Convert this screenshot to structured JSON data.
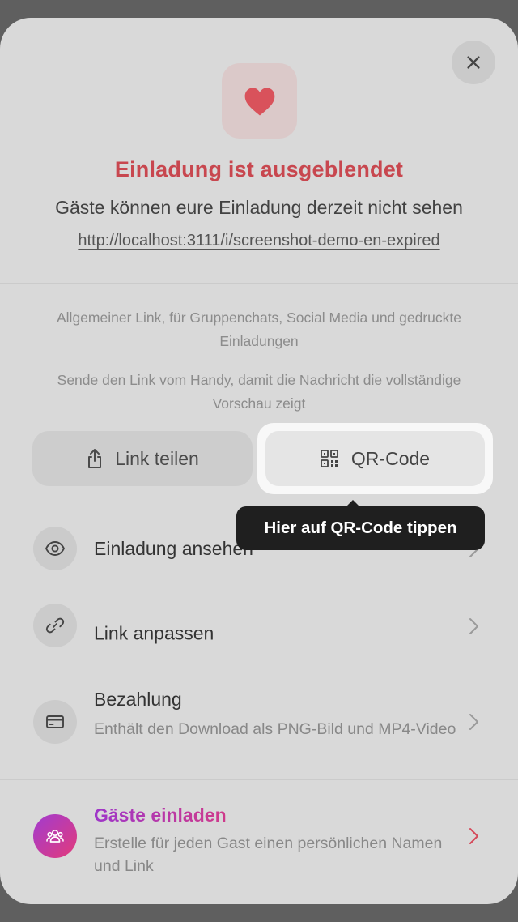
{
  "header": {
    "title": "Einladung ist ausgeblendet",
    "subtitle": "Gäste können eure Einladung derzeit nicht sehen",
    "url": "http://localhost:3111/i/screenshot-demo-en-expired"
  },
  "share": {
    "note_general": "Allgemeiner Link, für Gruppenchats, Social Media und gedruckte Einladungen",
    "note_phone": "Sende den Link vom Handy, damit die Nachricht die vollständige Vorschau zeigt",
    "share_label": "Link teilen",
    "qr_label": "QR-Code"
  },
  "tooltip": {
    "text": "Hier auf QR-Code tippen"
  },
  "menu": {
    "view_label": "Einladung ansehen",
    "customize_label": "Link anpassen",
    "payment_label": "Bezahlung",
    "payment_desc": "Enthält den Download als PNG-Bild und MP4-Video",
    "invite_label": "Gäste einladen",
    "invite_desc": "Erstelle für jeden Gast einen persönlichen Namen und Link"
  },
  "colors": {
    "title_red": "#c8474f",
    "heart": "#d9525b",
    "tooltip_bg": "#1f1f1f",
    "gradient_start": "#a13bd0",
    "gradient_end": "#e33b7a"
  },
  "icons": {
    "close": "close-icon",
    "heart": "heart-icon",
    "share": "share-icon",
    "qr": "qr-code-icon",
    "eye": "eye-icon",
    "link": "link-icon",
    "card": "credit-card-icon",
    "group": "group-icon",
    "chevron": "chevron-right-icon"
  }
}
